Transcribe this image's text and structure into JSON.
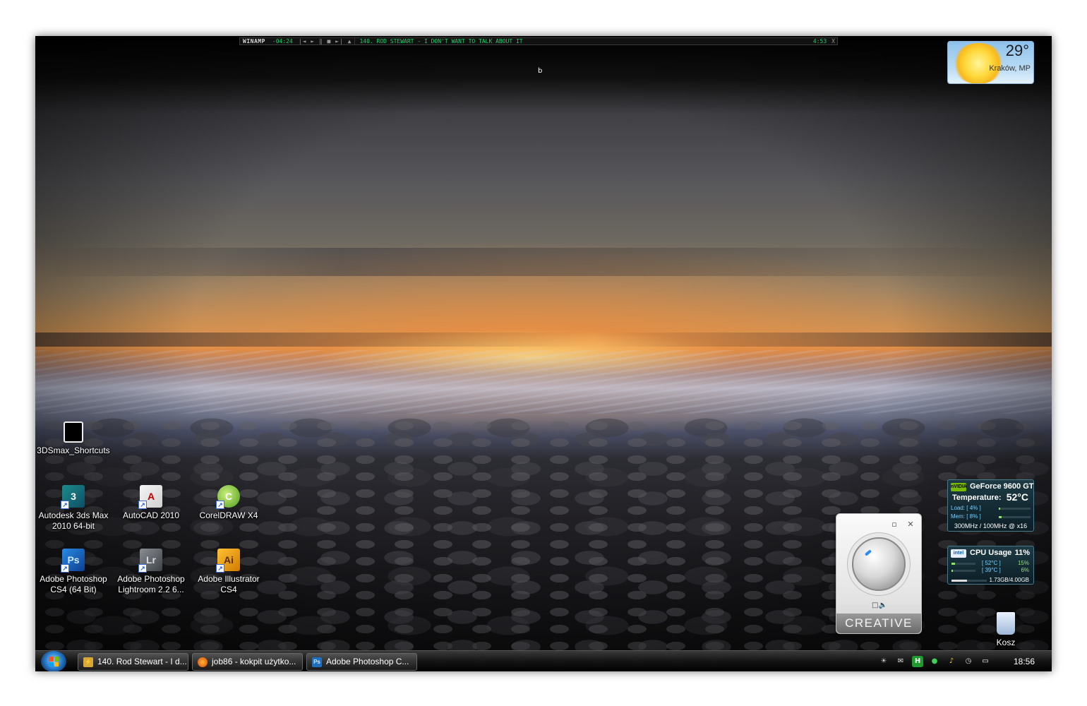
{
  "winamp": {
    "logo": "WINAMP",
    "elapsed": "-04:24",
    "controls": "|◄ ► ‖ ■ ►| ▲",
    "track": "140. ROD STEWART - I DON'T WANT TO TALK ABOUT IT",
    "duration": "4:53",
    "close": "X"
  },
  "desktop_letter": "b",
  "weather": {
    "temperature": "29°",
    "city": "Kraków, MP"
  },
  "icons": {
    "shortcuts_3ds": "3DSmax_Shortcuts",
    "max_3ds": "Autodesk 3ds Max 2010 64-bit",
    "autocad": "AutoCAD 2010",
    "coreldraw": "CorelDRAW X4",
    "photoshop": "Adobe Photoshop CS4 (64 Bit)",
    "lightroom": "Adobe Photoshop Lightroom 2.2 6...",
    "illustrator": "Adobe Illustrator CS4",
    "trash": "Kosz"
  },
  "icon_glyphs": {
    "max": "3",
    "acad": "A",
    "corel": "C",
    "ps": "Ps",
    "lr": "Lr",
    "ai": "Ai",
    "shortcut_arrow": "↗"
  },
  "creative": {
    "brand": "CREATIVE",
    "minimize": "▫",
    "close": "✕",
    "mute": "□🔈"
  },
  "gpu": {
    "badge": "nVIDIA",
    "title": "GeForce 9600 GT",
    "temperature_label": "Temperature:",
    "temperature_value": "52°C",
    "load_label": "Load: [ 4% ]",
    "load_fraction": 0.04,
    "mem_label": "Mem: [ 8% ]",
    "mem_fraction": 0.08,
    "clocks": "300MHz / 100MHz @ x16"
  },
  "cpu": {
    "badge": "intel",
    "title": "CPU Usage",
    "usage": "11%",
    "core1_temp": "[ 52°C ]",
    "core1_pct": "15%",
    "core1_fraction": 0.15,
    "core2_temp": "[ 39°C ]",
    "core2_pct": "6%",
    "core2_fraction": 0.06,
    "memory": "1.73GB/4.00GB",
    "memory_fraction": 0.43
  },
  "taskbar": {
    "tasks": [
      {
        "label": "140. Rod Stewart - I d...",
        "icon": "⚡"
      },
      {
        "label": "job86 - kokpit użytko...",
        "icon": ""
      },
      {
        "label": "Adobe Photoshop C...",
        "icon": "Ps"
      }
    ],
    "tray_icons": [
      "☀",
      "✉",
      "H",
      "●",
      "♪",
      "◷",
      "▭"
    ],
    "clock": "18:56"
  },
  "colors": {
    "winamp_text": "#1fd26a",
    "nvidia_green": "#76b900",
    "window_accent": "#2b7fd0"
  }
}
